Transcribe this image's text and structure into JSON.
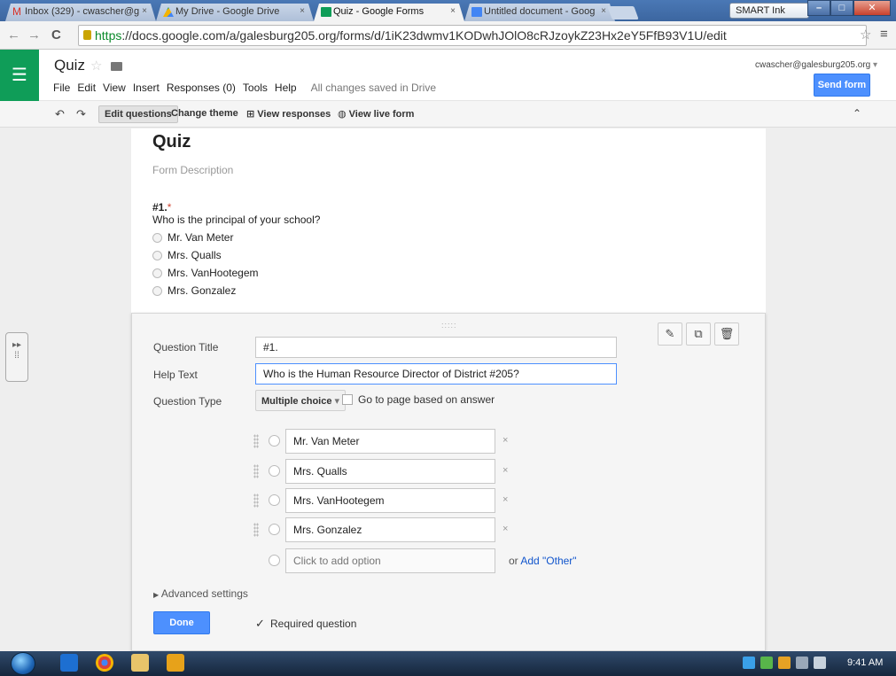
{
  "browser": {
    "tabs": [
      {
        "title": "Inbox (329) - cwascher@g",
        "close": "×",
        "fav_color": "#d93025"
      },
      {
        "title": "My Drive - Google Drive",
        "close": "×",
        "fav_color": "#f4b400"
      },
      {
        "title": "Quiz - Google Forms",
        "close": "×",
        "fav_color": "#0f9d58"
      },
      {
        "title": "Untitled document - Goog",
        "close": "×",
        "fav_color": "#4285f4"
      }
    ],
    "smart_ink": "SMART Ink",
    "url_scheme": "https",
    "url_rest": "://docs.google.com/a/galesburg205.org/forms/d/1iK23dwmv1KODwhJOlO8cRJzoykZ23Hx2eY5FfB93V1U/edit"
  },
  "app": {
    "title": "Quiz",
    "menus": [
      "File",
      "Edit",
      "View",
      "Insert",
      "Responses (0)",
      "Tools",
      "Help"
    ],
    "saved_status": "All changes saved in Drive",
    "user_email": "cwascher@galesburg205.org",
    "send_button": "Send form",
    "brand_color": "#0f9d58",
    "accent_color": "#4d90fe"
  },
  "toolbar": {
    "edit_questions": "Edit questions",
    "change_theme": "Change theme",
    "view_responses": "View responses",
    "view_live_form": "View live form"
  },
  "form": {
    "title": "Quiz",
    "description_placeholder": "Form Description",
    "question_number": "#1.",
    "required_mark": "*",
    "question_text": "Who is the principal of your school?",
    "preview_options": [
      "Mr. Van Meter",
      "Mrs. Qualls",
      "Mrs. VanHootegem",
      "Mrs. Gonzalez"
    ]
  },
  "editor": {
    "question_title_label": "Question Title",
    "question_title_value": "#1.",
    "help_text_label": "Help Text",
    "help_text_value": "Who is the Human Resource Director of District #205?",
    "question_type_label": "Question Type",
    "question_type_value": "Multiple choice",
    "goto_page_label": "Go to page based on answer",
    "options": [
      "Mr. Van Meter",
      "Mrs. Qualls",
      "Mrs. VanHootegem",
      "Mrs. Gonzalez"
    ],
    "remove_symbol": "×",
    "add_option_placeholder": "Click to add option",
    "or_text": "or",
    "add_other": "Add \"Other\"",
    "advanced_settings": "Advanced settings",
    "done_button": "Done",
    "required_question": "Required question",
    "required_checked": true
  },
  "taskbar": {
    "clock": "9:41 AM"
  }
}
